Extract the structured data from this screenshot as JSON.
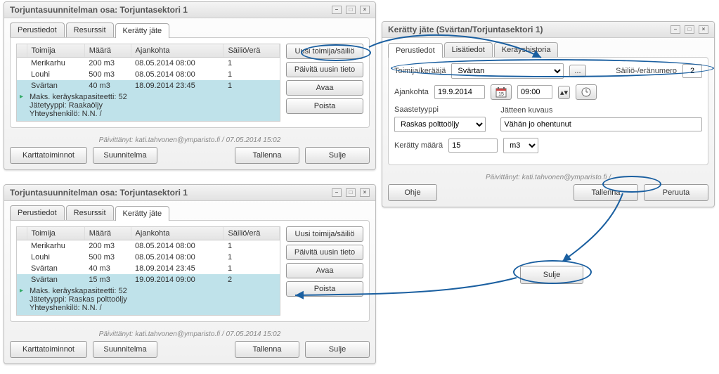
{
  "win1": {
    "title": "Torjuntasuunnitelman osa: Torjuntasektori 1",
    "tabs": {
      "t1": "Perustiedot",
      "t2": "Resurssit",
      "t3": "Kerätty jäte"
    },
    "cols": {
      "c1": "Toimija",
      "c2": "Määrä",
      "c3": "Ajankohta",
      "c4": "Säiliö/erä"
    },
    "rows": [
      {
        "a": "Merikarhu",
        "b": "200 m3",
        "c": "08.05.2014 08:00",
        "d": "1"
      },
      {
        "a": "Louhi",
        "b": "500 m3",
        "c": "08.05.2014 08:00",
        "d": "1"
      },
      {
        "a": "Svärtan",
        "b": "40 m3",
        "c": "18.09.2014 23:45",
        "d": "1"
      }
    ],
    "detail": {
      "cap": "Maks. keräyskapasiteetti:  52",
      "type": "Jätetyyppi:  Raakaöljy",
      "contact": "Yhteyshenkilö:  N.N. /"
    },
    "btns": {
      "b1": "Uusi toimija/säiliö",
      "b2": "Päivitä uusin tieto",
      "b3": "Avaa",
      "b4": "Poista"
    },
    "footer": "Päivittänyt: kati.tahvonen@ymparisto.fi / 07.05.2014 15:02",
    "bot": {
      "b1": "Karttatoiminnot",
      "b2": "Suunnitelma",
      "b3": "Tallenna",
      "b4": "Sulje"
    }
  },
  "win2": {
    "title": "Kerätty jäte (Svärtan/Torjuntasektori 1)",
    "tabs": {
      "t1": "Perustiedot",
      "t2": "Lisätiedot",
      "t3": "Keräyshistoria"
    },
    "f": {
      "collector_lbl": "Toimija/kerääjä",
      "collector_val": "Svärtan",
      "more": "...",
      "tank_lbl": "Säiliö-/eränumero",
      "tank_val": "2",
      "time_lbl": "Ajankohta",
      "date_val": "19.9.2014",
      "time_val": "09:00",
      "polltype_lbl": "Saastetyyppi",
      "polltype_val": "Raskas polttoöljy",
      "desc_lbl": "Jätteen kuvaus",
      "desc_val": "Vähän jo ohentunut",
      "amt_lbl": "Kerätty määrä",
      "amt_val": "15",
      "unit_val": "m3"
    },
    "footer": "Päivittänyt: kati.tahvonen@ymparisto.fi /",
    "bot": {
      "b1": "Ohje",
      "b2": "Tallenna",
      "b3": "Peruuta"
    }
  },
  "win3": {
    "title": "Torjuntasuunnitelman osa: Torjuntasektori 1",
    "tabs": {
      "t1": "Perustiedot",
      "t2": "Resurssit",
      "t3": "Kerätty jäte"
    },
    "cols": {
      "c1": "Toimija",
      "c2": "Määrä",
      "c3": "Ajankohta",
      "c4": "Säiliö/erä"
    },
    "rows": [
      {
        "a": "Merikarhu",
        "b": "200 m3",
        "c": "08.05.2014 08:00",
        "d": "1"
      },
      {
        "a": "Louhi",
        "b": "500 m3",
        "c": "08.05.2014 08:00",
        "d": "1"
      },
      {
        "a": "Svärtan",
        "b": "40 m3",
        "c": "18.09.2014 23:45",
        "d": "1"
      },
      {
        "a": "Svärtan",
        "b": "15 m3",
        "c": "19.09.2014 09:00",
        "d": "2"
      }
    ],
    "detail": {
      "cap": "Maks. keräyskapasiteetti:  52",
      "type": "Jätetyyppi:   Raskas polttoöljy",
      "contact": "Yhteyshenkilö:  N.N. /"
    },
    "btns": {
      "b1": "Uusi toimija/säiliö",
      "b2": "Päivitä uusin tieto",
      "b3": "Avaa",
      "b4": "Poista"
    },
    "footer": "Päivittänyt: kati.tahvonen@ymparisto.fi / 07.05.2014 15:02",
    "bot": {
      "b1": "Karttatoiminnot",
      "b2": "Suunnitelma",
      "b3": "Tallenna",
      "b4": "Sulje"
    }
  },
  "center": {
    "sulje": "Sulje"
  }
}
